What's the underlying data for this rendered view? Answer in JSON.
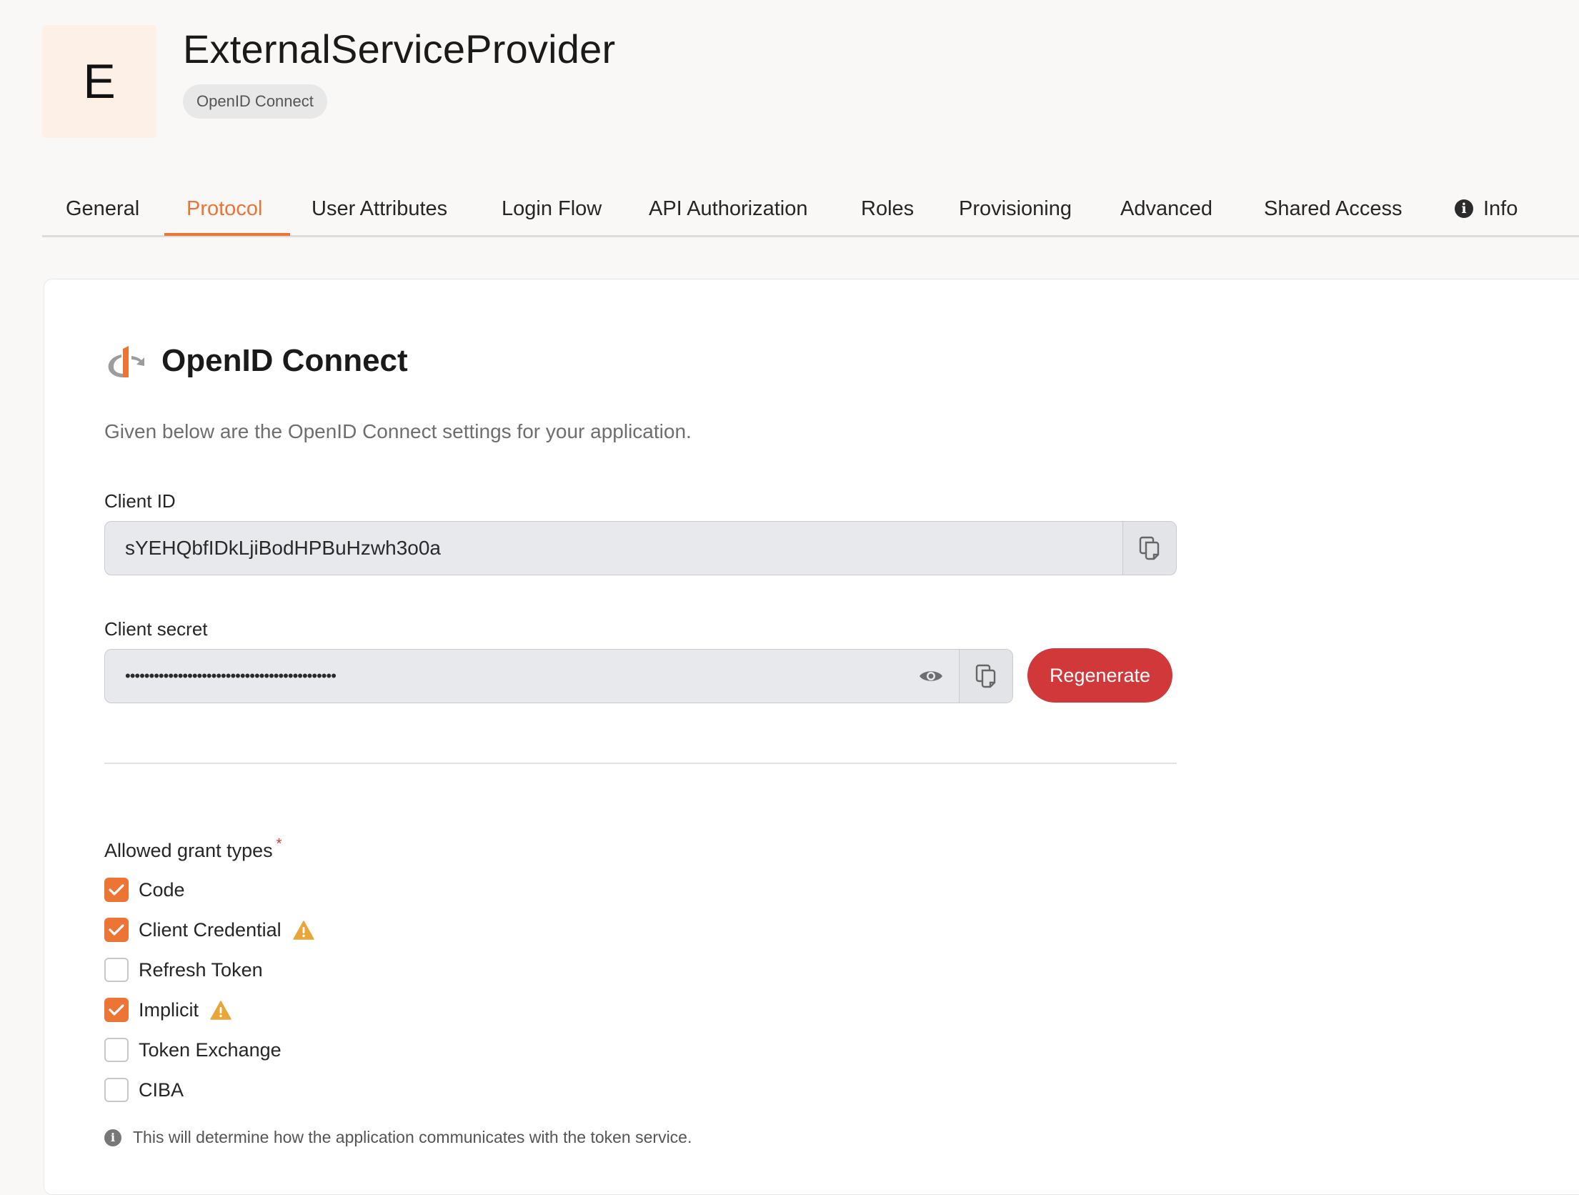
{
  "app": {
    "avatar_letter": "E",
    "title": "ExternalServiceProvider",
    "protocol_badge": "OpenID Connect"
  },
  "tabs": [
    {
      "label": "General",
      "active": false
    },
    {
      "label": "Protocol",
      "active": true
    },
    {
      "label": "User Attributes",
      "active": false
    },
    {
      "label": "Login Flow",
      "active": false
    },
    {
      "label": "API Authorization",
      "active": false
    },
    {
      "label": "Roles",
      "active": false
    },
    {
      "label": "Provisioning",
      "active": false
    },
    {
      "label": "Advanced",
      "active": false
    },
    {
      "label": "Shared Access",
      "active": false
    },
    {
      "label": "Info",
      "active": false,
      "icon": "info-icon"
    }
  ],
  "section": {
    "title": "OpenID Connect",
    "description": "Given below are the OpenID Connect settings for your application.",
    "logo_icon": "openid-logo-icon"
  },
  "client_id": {
    "label": "Client ID",
    "value": "sYEHQbfIDkLjiBodHPBuHzwh3o0a"
  },
  "client_secret": {
    "label": "Client secret",
    "masked_value": "••••••••••••••••••••••••••••••••••••••••••••",
    "regenerate_label": "Regenerate"
  },
  "grant_types": {
    "label": "Allowed grant types",
    "required_mark": "*",
    "options": [
      {
        "label": "Code",
        "checked": true,
        "warning": false
      },
      {
        "label": "Client Credential",
        "checked": true,
        "warning": true
      },
      {
        "label": "Refresh Token",
        "checked": false,
        "warning": false
      },
      {
        "label": "Implicit",
        "checked": true,
        "warning": true
      },
      {
        "label": "Token Exchange",
        "checked": false,
        "warning": false
      },
      {
        "label": "CIBA",
        "checked": false,
        "warning": false
      }
    ],
    "hint": "This will determine how the application communicates with the token service."
  },
  "colors": {
    "accent": "#ec7435",
    "danger": "#d0383a",
    "warning": "#e8a63a"
  }
}
